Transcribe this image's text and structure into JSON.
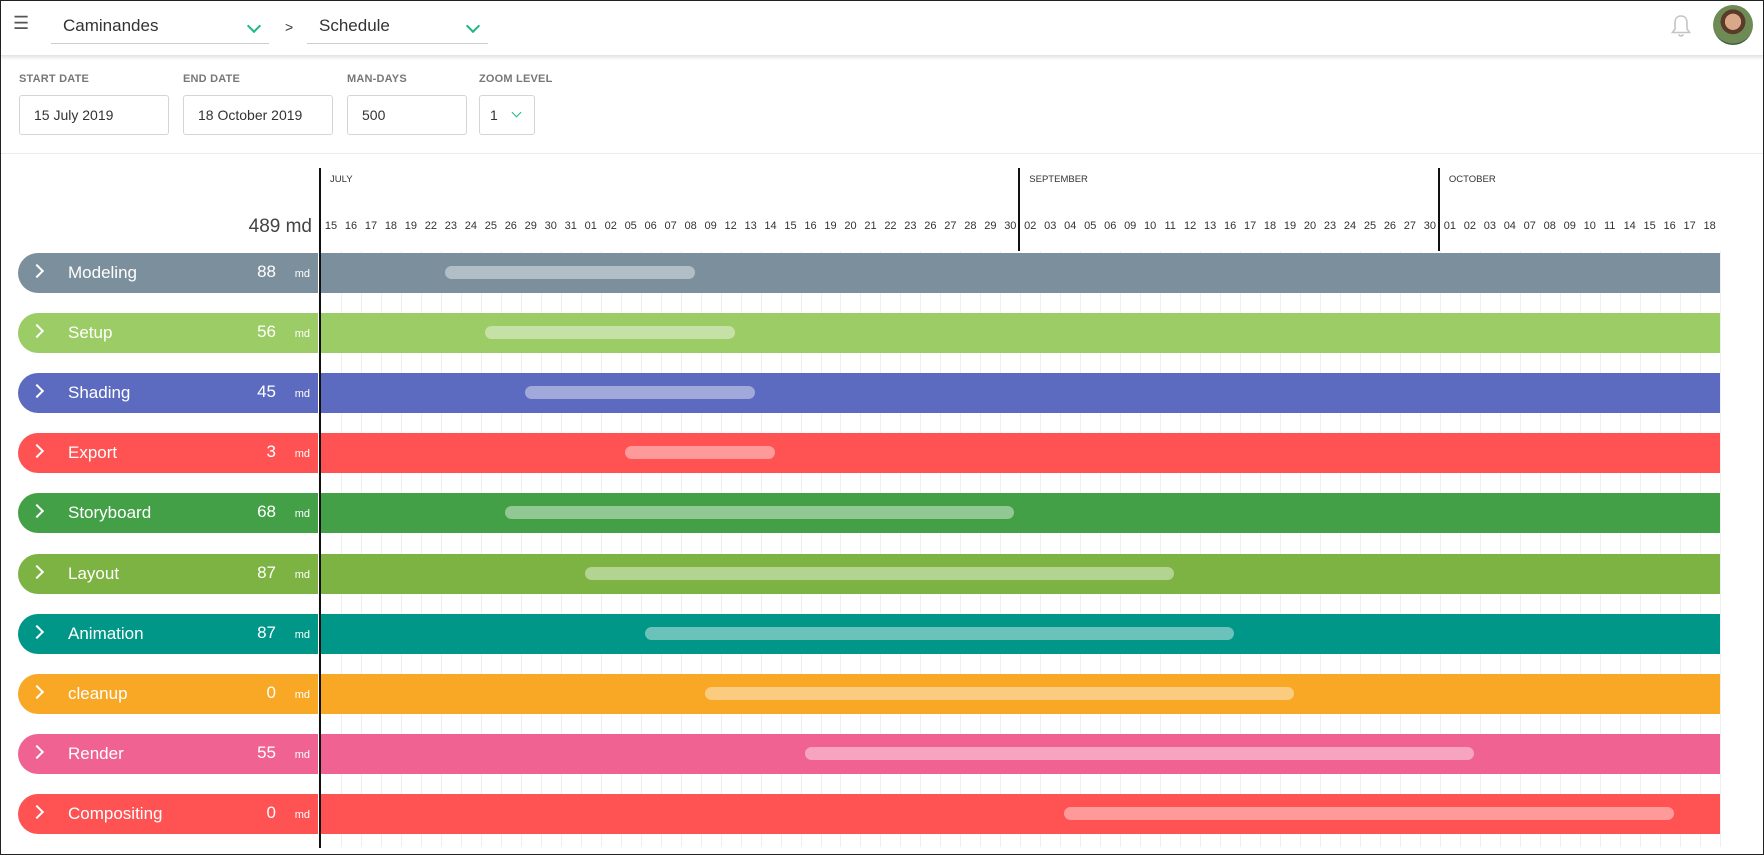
{
  "header": {
    "project": "Caminandes",
    "separator": ">",
    "view": "Schedule"
  },
  "filters": {
    "start_date": {
      "label": "START DATE",
      "value": "15 July 2019"
    },
    "end_date": {
      "label": "END DATE",
      "value": "18 October 2019"
    },
    "man_days": {
      "label": "MAN-DAYS",
      "value": "500"
    },
    "zoom_level": {
      "label": "ZOOM LEVEL",
      "value": "1"
    }
  },
  "timeline": {
    "total": "489 md",
    "months": [
      {
        "name": "JULY",
        "start_index": 0
      },
      {
        "name": "SEPTEMBER",
        "start_index": 35
      },
      {
        "name": "OCTOBER",
        "start_index": 56
      }
    ],
    "days": [
      "15",
      "16",
      "17",
      "18",
      "19",
      "22",
      "23",
      "24",
      "25",
      "26",
      "29",
      "30",
      "31",
      "01",
      "02",
      "05",
      "06",
      "07",
      "08",
      "09",
      "12",
      "13",
      "14",
      "15",
      "16",
      "19",
      "20",
      "21",
      "22",
      "23",
      "26",
      "27",
      "28",
      "29",
      "30",
      "02",
      "03",
      "04",
      "05",
      "06",
      "09",
      "10",
      "11",
      "12",
      "13",
      "16",
      "17",
      "18",
      "19",
      "20",
      "23",
      "24",
      "25",
      "26",
      "27",
      "30",
      "01",
      "02",
      "03",
      "04",
      "07",
      "08",
      "09",
      "10",
      "11",
      "14",
      "15",
      "16",
      "17",
      "18"
    ]
  },
  "tasks": [
    {
      "name": "Modeling",
      "md": "88",
      "unit": "md",
      "color": "#7b909c",
      "bar_start": 6.2,
      "bar_end": 18.7
    },
    {
      "name": "Setup",
      "md": "56",
      "unit": "md",
      "color": "#9ccc65",
      "bar_start": 8.2,
      "bar_end": 20.7
    },
    {
      "name": "Shading",
      "md": "45",
      "unit": "md",
      "color": "#5c6bc0",
      "bar_start": 10.2,
      "bar_end": 21.7
    },
    {
      "name": "Export",
      "md": "3",
      "unit": "md",
      "color": "#ff5252",
      "bar_start": 15.2,
      "bar_end": 22.7
    },
    {
      "name": "Storyboard",
      "md": "68",
      "unit": "md",
      "color": "#43a047",
      "bar_start": 9.2,
      "bar_end": 34.7
    },
    {
      "name": "Layout",
      "md": "87",
      "unit": "md",
      "color": "#7cb342",
      "bar_start": 13.2,
      "bar_end": 42.7
    },
    {
      "name": "Animation",
      "md": "87",
      "unit": "md",
      "color": "#009688",
      "bar_start": 16.2,
      "bar_end": 45.7
    },
    {
      "name": "cleanup",
      "md": "0",
      "unit": "md",
      "color": "#f9a825",
      "bar_start": 19.2,
      "bar_end": 48.7
    },
    {
      "name": "Render",
      "md": "55",
      "unit": "md",
      "color": "#f06292",
      "bar_start": 24.2,
      "bar_end": 57.7
    },
    {
      "name": "Compositing",
      "md": "0",
      "unit": "md",
      "color": "#ff5252",
      "bar_start": 37.2,
      "bar_end": 67.7
    }
  ]
}
